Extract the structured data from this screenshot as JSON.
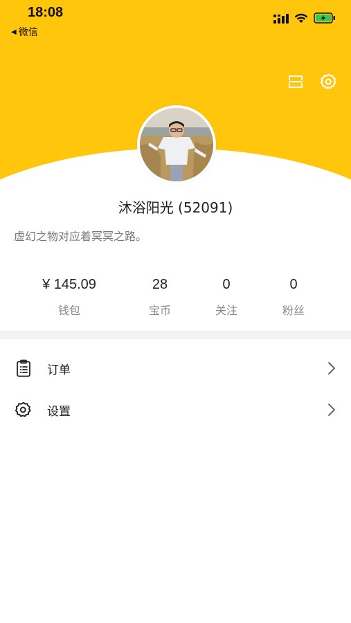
{
  "status_bar": {
    "time": "18:08",
    "back_app": "微信",
    "back_arrow_icon": "back-triangle-icon"
  },
  "colors": {
    "accent": "#FFC60B",
    "divider": "#F3F3F3",
    "muted_text": "#888888"
  },
  "top_actions": [
    {
      "icon": "scan-icon"
    },
    {
      "icon": "gear-icon"
    }
  ],
  "profile": {
    "nickname": "沐浴阳光 (52091)",
    "bio": "虚幻之物对应着冥冥之路。",
    "avatar_icon": "avatar-photo"
  },
  "stats": [
    {
      "value": "¥ 145.09",
      "label": "钱包"
    },
    {
      "value": "28",
      "label": "宝币"
    },
    {
      "value": "0",
      "label": "关注"
    },
    {
      "value": "0",
      "label": "粉丝"
    }
  ],
  "menu": [
    {
      "label": "订单",
      "icon": "clipboard-icon"
    },
    {
      "label": "设置",
      "icon": "gear-icon"
    }
  ]
}
